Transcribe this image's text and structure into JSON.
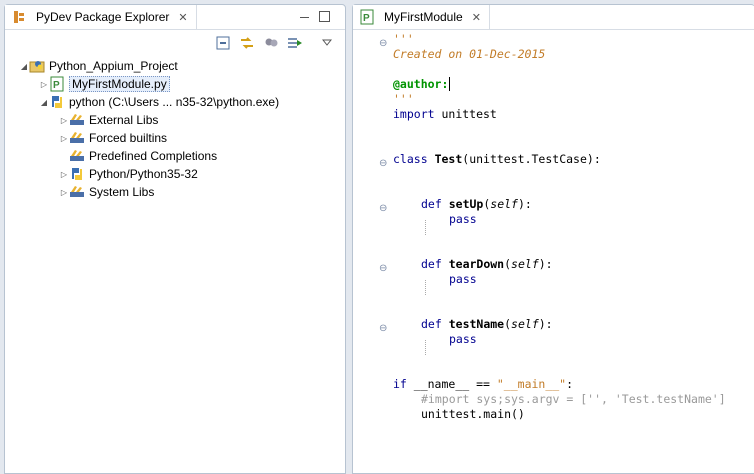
{
  "explorer": {
    "tab_title": "PyDev Package Explorer",
    "tree": [
      {
        "label": "Python_Appium_Project",
        "icon": "project-icon"
      },
      {
        "label": "MyFirstModule.py",
        "icon": "python-file-icon"
      },
      {
        "label": "python  (C:\\Users ... n35-32\\python.exe)",
        "icon": "python-interpreter-icon"
      },
      {
        "label": "External Libs",
        "icon": "library-icon"
      },
      {
        "label": "Forced builtins",
        "icon": "library-icon"
      },
      {
        "label": "Predefined Completions",
        "icon": "library-icon"
      },
      {
        "label": "Python/Python35-32",
        "icon": "python-interpreter-icon"
      },
      {
        "label": "System Libs",
        "icon": "library-icon"
      }
    ]
  },
  "editor": {
    "tab_title": "MyFirstModule",
    "code": {
      "l1": "'''",
      "l2": "Created on 01-Dec-2015",
      "l3": "@author:",
      "l4": "'''",
      "l5_kw": "import",
      "l5_rest": " unittest",
      "l6_kw": "class",
      "l6_name": "Test",
      "l6_rest": "(unittest.TestCase):",
      "l7_kw": "def",
      "l7_name": "setUp",
      "l7_open": "(",
      "l7_self": "self",
      "l7_close": "):",
      "l8": "pass",
      "l9_kw": "def",
      "l9_name": "tearDown",
      "l9_open": "(",
      "l9_self": "self",
      "l9_close": "):",
      "l10": "pass",
      "l11_kw": "def",
      "l11_name": "testName",
      "l11_open": "(",
      "l11_self": "self",
      "l11_close": "):",
      "l12": "pass",
      "l13_kw": "if",
      "l13_mid": " __name__ == ",
      "l13_str": "\"__main__\"",
      "l13_end": ":",
      "l14": "#import sys;sys.argv = ['', 'Test.testName']",
      "l15": "unittest.main()"
    }
  },
  "colors": {
    "docstring": "#c27c28",
    "keyword": "#00008f",
    "decorator": "#009400",
    "comment": "#9a9a9a"
  }
}
